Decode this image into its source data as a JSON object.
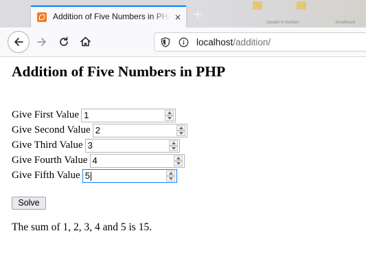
{
  "browser": {
    "tab_title": "Addition of Five Numbers in PHP",
    "tab_close": "×",
    "new_tab": "+",
    "url_host": "localhost",
    "url_path": "/addition/",
    "background_labels": [
      "squads in burdten",
      "Jurodhaosi"
    ]
  },
  "page": {
    "heading": "Addition of Five Numbers in PHP",
    "fields": [
      {
        "label": "Give First Value",
        "value": "1"
      },
      {
        "label": "Give Second Value",
        "value": "2"
      },
      {
        "label": "Give Third Value",
        "value": "3"
      },
      {
        "label": "Give Fourth Value",
        "value": "4"
      },
      {
        "label": "Give Fifth Value",
        "value": "5"
      }
    ],
    "solve_label": "Solve",
    "result": "The sum of 1, 2, 3, 4 and 5 is 15."
  },
  "colors": {
    "tab_accent": "#0a84ff",
    "tab_strip": "#dcdbe0",
    "favicon": "#f47b20"
  }
}
